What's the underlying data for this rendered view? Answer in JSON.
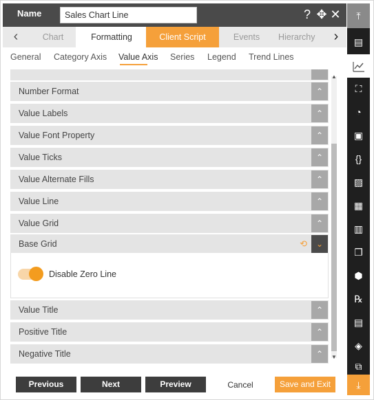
{
  "header": {
    "name_label": "Name",
    "name_value": "Sales Chart Line",
    "help_icon": "?",
    "move_icon": "✥",
    "close_icon": "✕"
  },
  "tabs": [
    {
      "label": "Chart"
    },
    {
      "label": "Formatting"
    },
    {
      "label": "Client Script"
    },
    {
      "label": "Events"
    },
    {
      "label": "Hierarchy"
    }
  ],
  "subtabs": [
    {
      "label": "General"
    },
    {
      "label": "Category Axis"
    },
    {
      "label": "Value Axis"
    },
    {
      "label": "Series"
    },
    {
      "label": "Legend"
    },
    {
      "label": "Trend Lines"
    }
  ],
  "sections": [
    {
      "label": "Number Format"
    },
    {
      "label": "Value Labels"
    },
    {
      "label": "Value Font Property"
    },
    {
      "label": "Value Ticks"
    },
    {
      "label": "Value Alternate Fills"
    },
    {
      "label": "Value Line"
    },
    {
      "label": "Value Grid"
    },
    {
      "label": "Base Grid"
    },
    {
      "label": "Value Title"
    },
    {
      "label": "Positive Title"
    },
    {
      "label": "Negative Title"
    }
  ],
  "base_grid": {
    "toggle_label": "Disable Zero Line",
    "toggle_on": true
  },
  "footer": {
    "previous": "Previous",
    "next": "Next",
    "preview": "Preview",
    "cancel": "Cancel",
    "save": "Save and Exit"
  },
  "colors": {
    "accent": "#f5a03a",
    "header_bg": "#4a4a4a",
    "sidebar_bg": "#1f1f1f"
  },
  "sidebar_icons": [
    "collapse-top-icon",
    "table-icon",
    "line-chart-icon",
    "map-icon",
    "gauge-icon",
    "document-icon",
    "braces-icon",
    "image-icon",
    "scorecard-icon",
    "bar-chart-icon",
    "copy-icon",
    "cubes-icon",
    "rx-icon",
    "report-icon",
    "layers-icon",
    "widgets-icon",
    "download-icon"
  ]
}
